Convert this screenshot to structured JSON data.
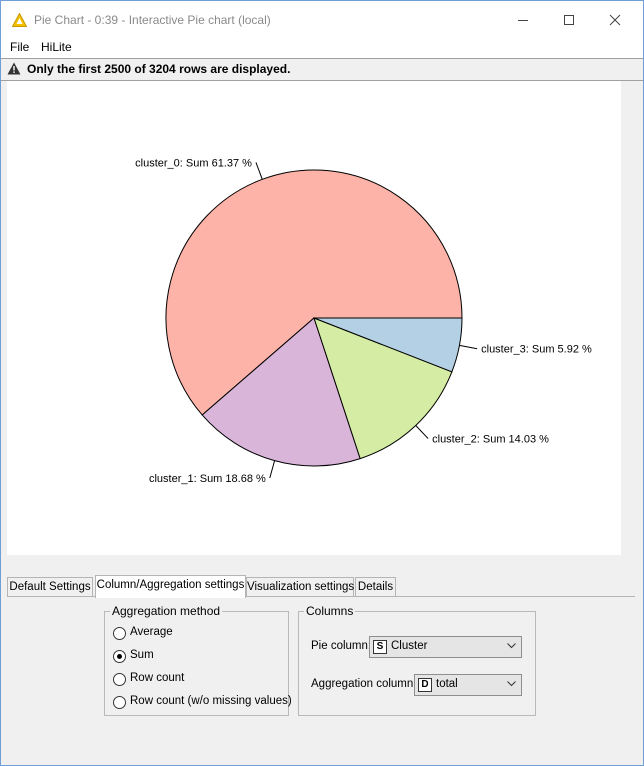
{
  "window": {
    "title": "Pie Chart - 0:39 - Interactive Pie chart (local)"
  },
  "menu": {
    "items": [
      "File",
      "HiLite"
    ]
  },
  "warning": {
    "text": "Only the first 2500 of 3204 rows are displayed."
  },
  "chart_data": {
    "type": "pie",
    "categories": [
      "cluster_0",
      "cluster_1",
      "cluster_2",
      "cluster_3"
    ],
    "values": [
      61.37,
      18.68,
      14.03,
      5.92
    ],
    "labels": [
      "cluster_0: Sum 61.37 %",
      "cluster_1: Sum 18.68 %",
      "cluster_2: Sum 14.03 %",
      "cluster_3: Sum 5.92 %"
    ],
    "colors": [
      "#fdb3a8",
      "#d9b5d9",
      "#d5eca4",
      "#b4d0e4"
    ]
  },
  "tabs": [
    {
      "label": "Default Settings",
      "active": false
    },
    {
      "label": "Column/Aggregation settings",
      "active": true
    },
    {
      "label": "Visualization settings",
      "active": false
    },
    {
      "label": "Details",
      "active": false
    }
  ],
  "aggregation": {
    "legend": "Aggregation method",
    "options": [
      {
        "label": "Average",
        "selected": false
      },
      {
        "label": "Sum",
        "selected": true
      },
      {
        "label": "Row count",
        "selected": false
      },
      {
        "label": "Row count (w/o missing values)",
        "selected": false
      }
    ]
  },
  "columns": {
    "legend": "Columns",
    "pie_column": {
      "label": "Pie column:",
      "type": "S",
      "value": "Cluster"
    },
    "aggregation_column": {
      "label": "Aggregation column:",
      "type": "D",
      "value": "total"
    }
  }
}
